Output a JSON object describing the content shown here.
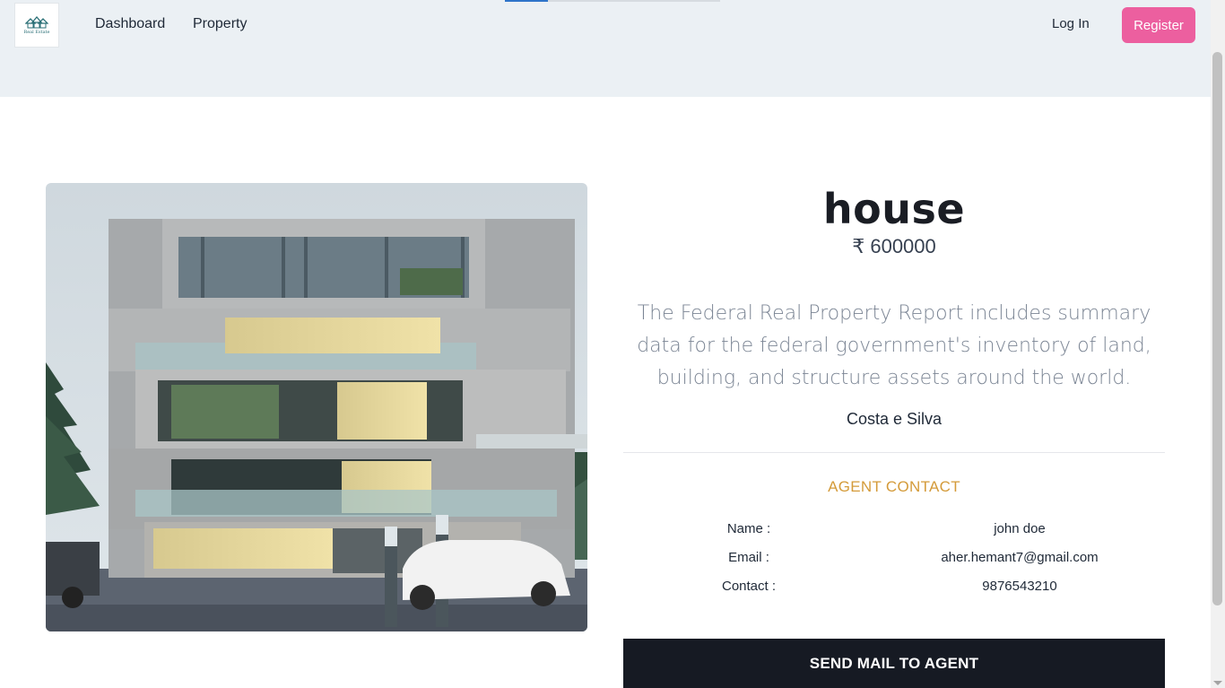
{
  "header": {
    "logo_text": "Real Estate",
    "nav": [
      {
        "label": "Dashboard"
      },
      {
        "label": "Property"
      }
    ],
    "login_label": "Log In",
    "register_label": "Register",
    "load_progress": 0.2
  },
  "property": {
    "title": "house",
    "price": "₹ 600000",
    "description": "The Federal Real Property Report includes summary data for the federal government's inventory of land, building, and structure assets around the world.",
    "location": "Costa e Silva",
    "image_alt": "Modern multi-storey house"
  },
  "agent": {
    "heading": "AGENT CONTACT",
    "rows": [
      {
        "key": "Name :",
        "value": "john doe"
      },
      {
        "key": "Email :",
        "value": "aher.hemant7@gmail.com"
      },
      {
        "key": "Contact :",
        "value": "9876543210"
      }
    ]
  },
  "actions": {
    "send_mail_label": "SEND MAIL TO AGENT"
  },
  "colors": {
    "header_bg": "#ebf0f4",
    "accent_pink": "#ec5f9f",
    "agent_heading": "#d49b3a",
    "dark_button": "#161a23"
  }
}
